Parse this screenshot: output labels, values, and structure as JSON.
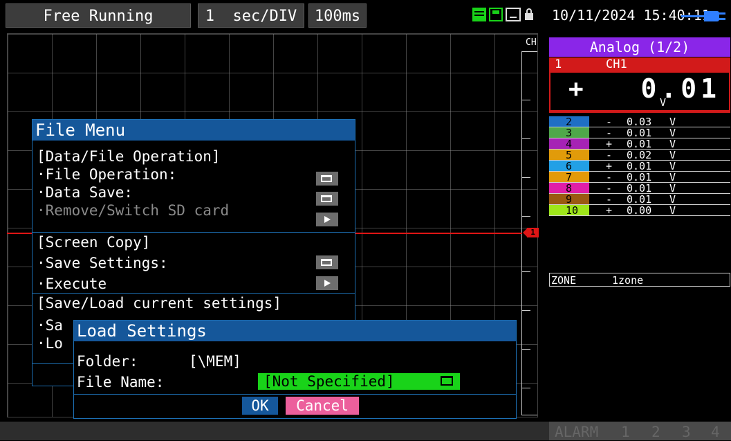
{
  "topbar": {
    "mode": "Free Running",
    "sec_div_value": "1",
    "sec_div_unit": "sec/DIV",
    "sampling": "100ms",
    "datetime": "10/11/2024 15:40:11",
    "icons": [
      "memory-icon",
      "sd-card-icon",
      "usb-icon",
      "lock-icon",
      "power-plug-icon"
    ]
  },
  "graph": {
    "axis_label": "CH",
    "marker_label": "1",
    "trace_color": "#e01515"
  },
  "panel": {
    "header": "Analog (1/2)",
    "header_color": "#8a26e8",
    "ch1": {
      "number": "1",
      "name": "CH1",
      "sign": "+",
      "value": "0.01",
      "unit": "V",
      "color": "#d21a1a"
    },
    "channels": [
      {
        "number": "2",
        "sign": "-",
        "value": "0.03",
        "unit": "V",
        "color": "#1f6fc4"
      },
      {
        "number": "3",
        "sign": "-",
        "value": "0.01",
        "unit": "V",
        "color": "#4fa84a"
      },
      {
        "number": "4",
        "sign": "+",
        "value": "0.01",
        "unit": "V",
        "color": "#a623b5"
      },
      {
        "number": "5",
        "sign": "-",
        "value": "0.02",
        "unit": "V",
        "color": "#e19b0a"
      },
      {
        "number": "6",
        "sign": "+",
        "value": "0.01",
        "unit": "V",
        "color": "#22a0e6"
      },
      {
        "number": "7",
        "sign": "-",
        "value": "0.01",
        "unit": "V",
        "color": "#e39a09"
      },
      {
        "number": "8",
        "sign": "-",
        "value": "0.01",
        "unit": "V",
        "color": "#e01ea8"
      },
      {
        "number": "9",
        "sign": "-",
        "value": "0.01",
        "unit": "V",
        "color": "#9a5a12"
      },
      {
        "number": "10",
        "sign": "+",
        "value": "0.00",
        "unit": "V",
        "color": "#9ee61a"
      }
    ],
    "zone_label": "ZONE",
    "zone_value": "1zone"
  },
  "bottombar": {
    "alarm_label": "ALARM",
    "alarm_channels": [
      "1",
      "2",
      "3",
      "4"
    ]
  },
  "file_menu": {
    "title": "File Menu",
    "section_data": "[Data/File Operation]",
    "file_operation": "·File Operation:",
    "data_save": "·Data Save:",
    "remove_sd": "·Remove/Switch SD card",
    "section_screen": "[Screen Copy]",
    "save_settings": "·Save Settings:",
    "execute": "·Execute",
    "section_settings": "[Save/Load current settings]",
    "save_truncated": "·Sa",
    "load_truncated": "·Lo"
  },
  "load_dialog": {
    "title": "Load Settings",
    "folder_label": "Folder:",
    "folder_value": "[\\MEM]",
    "file_label": "File Name:",
    "file_value": "[Not Specified]",
    "ok": "OK",
    "cancel": "Cancel"
  }
}
